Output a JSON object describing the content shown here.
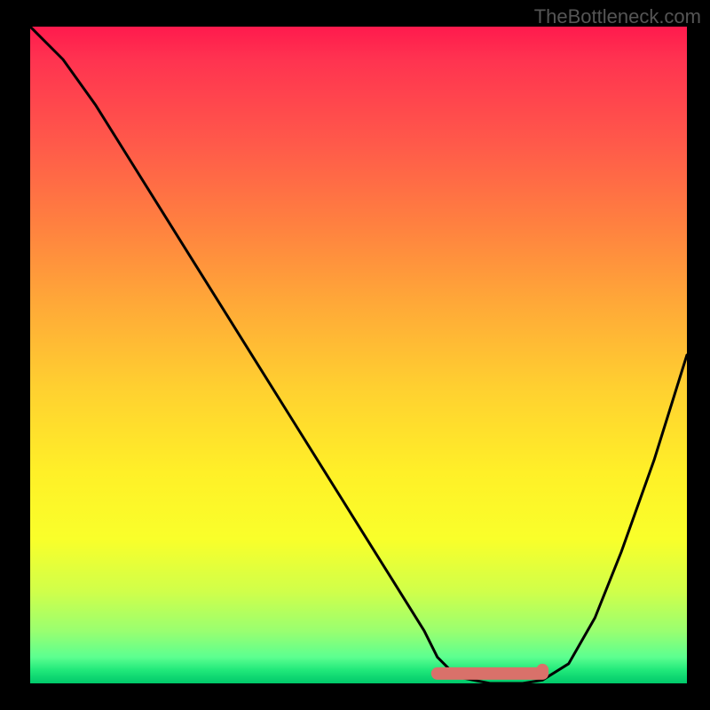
{
  "watermark": "TheBottleneck.com",
  "chart_data": {
    "type": "line",
    "title": "",
    "xlabel": "",
    "ylabel": "",
    "xlim": [
      0,
      100
    ],
    "ylim": [
      0,
      100
    ],
    "x": [
      0,
      5,
      10,
      15,
      20,
      25,
      30,
      35,
      40,
      45,
      50,
      55,
      60,
      62,
      65,
      70,
      75,
      78,
      82,
      86,
      90,
      95,
      100
    ],
    "values": [
      100,
      95,
      88,
      80,
      72,
      64,
      56,
      48,
      40,
      32,
      24,
      16,
      8,
      4,
      1,
      0,
      0,
      0.5,
      3,
      10,
      20,
      34,
      50
    ],
    "optimal_zone": {
      "x_start": 62,
      "x_end": 78,
      "y": 1.5
    },
    "gradient_meaning": "top=red (high bottleneck), bottom=green (no bottleneck)"
  }
}
